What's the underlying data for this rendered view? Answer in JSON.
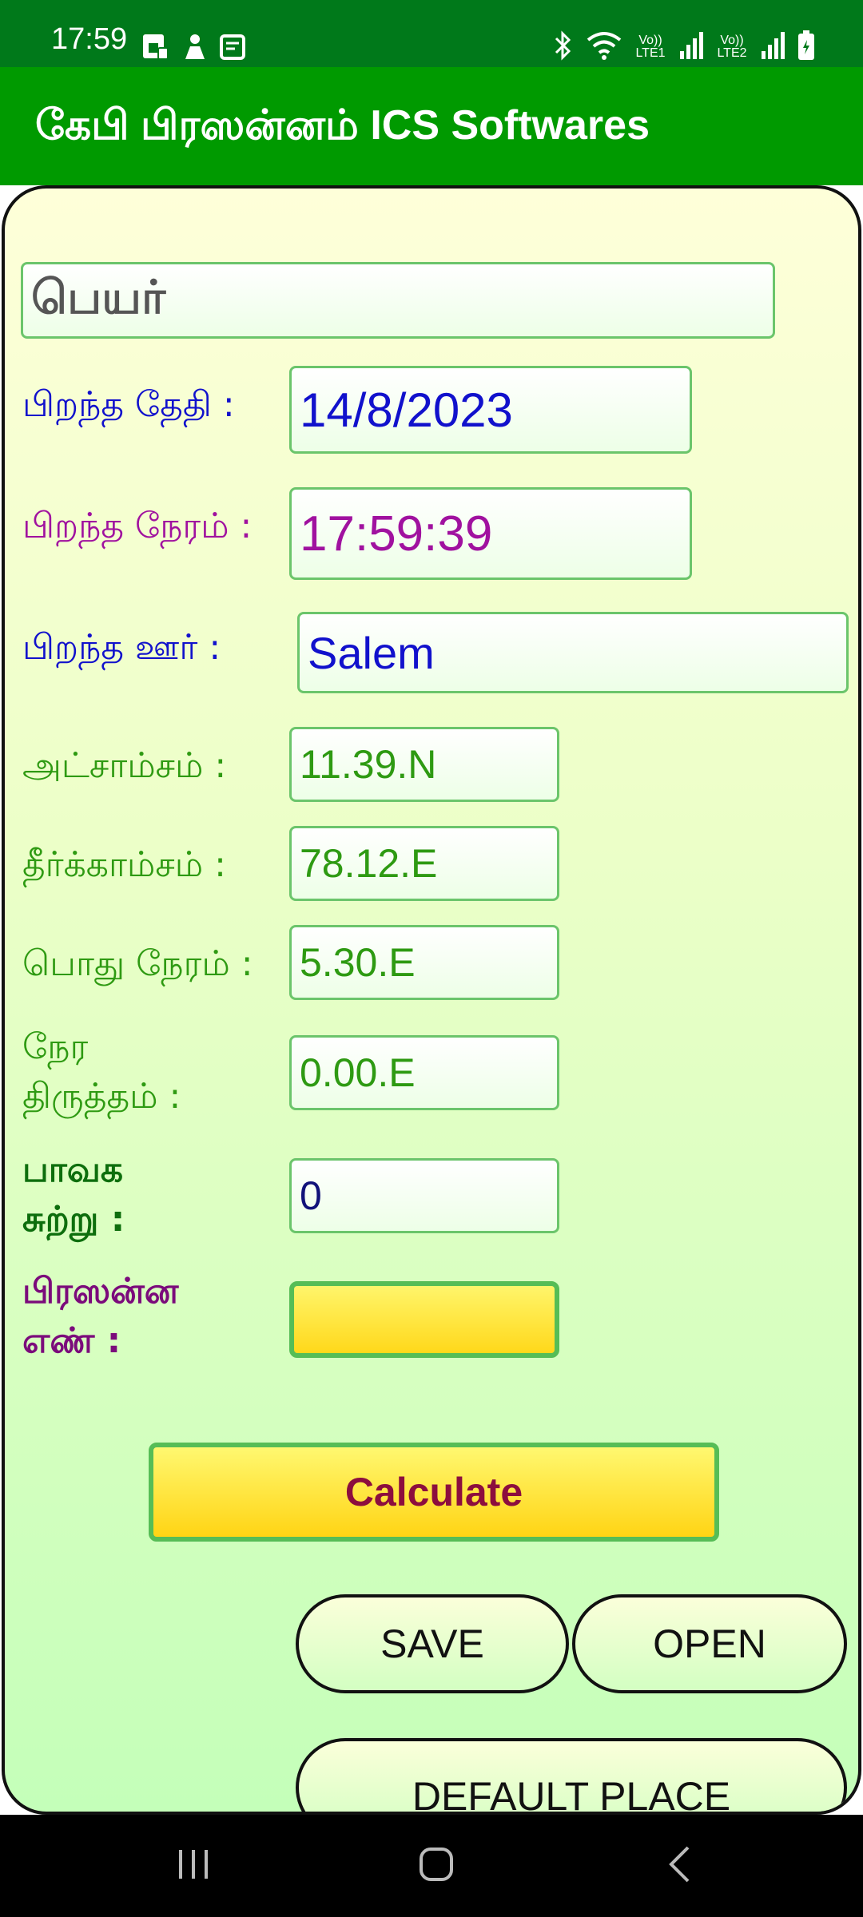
{
  "status_bar": {
    "time": "17:59",
    "sim1_label": "Vo)) LTE1",
    "sim2_label": "Vo)) LTE2"
  },
  "app_bar": {
    "title": "கேபி பிரஸன்னம் ICS Softwares"
  },
  "form": {
    "name_placeholder": "பெயர்",
    "birth_date_label": "பிறந்த தேதி :",
    "birth_date_value": "14/8/2023",
    "birth_time_label": "பிறந்த நேரம் :",
    "birth_time_value": "17:59:39",
    "birth_place_label": "பிறந்த ஊர் :",
    "birth_place_value": "Salem",
    "latitude_label": "அட்சாம்சம் :",
    "latitude_value": "11.39.N",
    "longitude_label": "தீர்க்காம்சம் :",
    "longitude_value": "78.12.E",
    "time_zone_label": "பொது நேரம் :",
    "time_zone_value": "5.30.E",
    "time_correction_label_1": "நேர",
    "time_correction_label_2": "திருத்தம் :",
    "time_correction_value": "0.00.E",
    "bhava_label_1": "பாவக",
    "bhava_label_2": "சுற்று :",
    "bhava_value": "0",
    "prasanna_label_1": "பிரஸன்ன",
    "prasanna_label_2": "எண் :",
    "prasanna_value": ""
  },
  "buttons": {
    "calculate": "Calculate",
    "save": "SAVE",
    "open": "OPEN",
    "default_place": "DEFAULT PLACE"
  },
  "colors": {
    "status_bar": "#00791a",
    "app_bar": "#009a00",
    "button_yellow": "#ffd814",
    "field_border": "#6bc56b"
  },
  "icons": {
    "status_left": [
      "sim-card-icon",
      "game-icon",
      "clipboard-icon"
    ],
    "status_right": [
      "bluetooth-icon",
      "wifi-icon",
      "signal-icon",
      "battery-icon"
    ],
    "nav": [
      "recents-icon",
      "home-icon",
      "back-icon"
    ]
  }
}
